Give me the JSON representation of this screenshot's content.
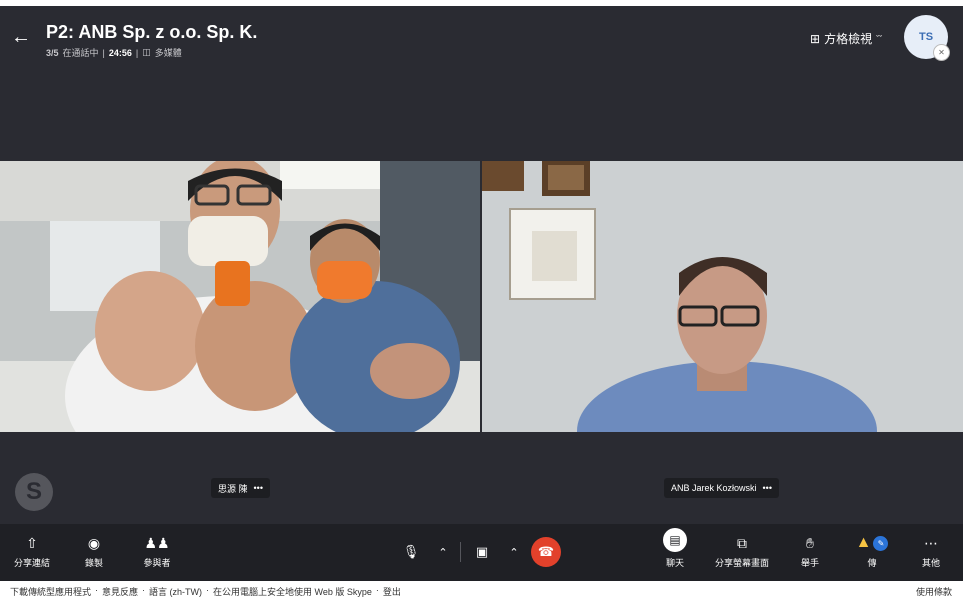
{
  "header": {
    "title": "P2: ANB Sp. z o.o. Sp. K.",
    "participant_count": "3/5",
    "status": "在通話中",
    "separator": "|",
    "duration": "24:56",
    "media_label": "多媒體",
    "grid_view_label": "方格檢視",
    "avatar_initials": "TS"
  },
  "participants": [
    {
      "name": "思源 陳",
      "more": "•••"
    },
    {
      "name": "ANB Jarek Kozłowski",
      "more": "•••"
    }
  ],
  "toolbar": {
    "share_link": "分享連結",
    "record": "錄製",
    "participants": "參與者",
    "chat": "聊天",
    "share_screen": "分享螢幕畫面",
    "raise_hand": "舉手",
    "send": "傳",
    "more": "其他"
  },
  "statusbar": {
    "links": [
      "下載傳統型應用程式",
      "意見反應",
      "語言 (zh-TW)",
      "在公用電腦上安全地使用 Web 版 Skype",
      "登出"
    ],
    "separator": "·",
    "terms": "使用條款"
  },
  "colors": {
    "app_bg": "#2a2b32",
    "toolbar_bg": "#1f2025",
    "hangup": "#e2412b",
    "avatar_text": "#3b6db4"
  }
}
